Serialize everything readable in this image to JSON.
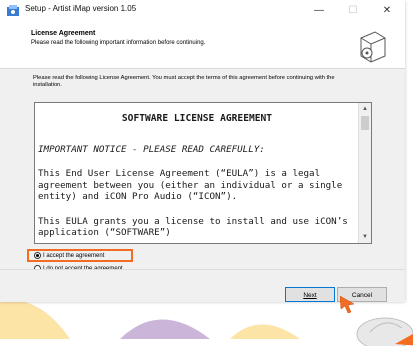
{
  "window": {
    "title": "Setup - Artist iMap version 1.05",
    "minimize": "—",
    "maximize": "☐",
    "close": "✕"
  },
  "header": {
    "title": "License Agreement",
    "subtitle": "Please read the following important information before continuing."
  },
  "intro": "Please read the following License Agreement. You must accept the terms of this agreement before continuing with the installation.",
  "license": {
    "heading": "SOFTWARE LICENSE AGREEMENT",
    "notice": "IMPORTANT NOTICE - PLEASE READ CAREFULLY:",
    "para1": "This End User License Agreement (“EULA”) is a legal agreement between you (either an individual or a single entity) and iCON Pro Audio (“ICON”).",
    "para2": "This EULA grants you a license to install and use iCON’s application (“SOFTWARE”)"
  },
  "options": {
    "accept": "I accept the agreement",
    "decline": "I do not accept the agreement",
    "selected": "accept"
  },
  "buttons": {
    "next": "Next",
    "cancel": "Cancel"
  },
  "colors": {
    "highlight": "#f36c21",
    "deco_purple": "#6a2c91",
    "deco_yellow": "#f5b000"
  }
}
